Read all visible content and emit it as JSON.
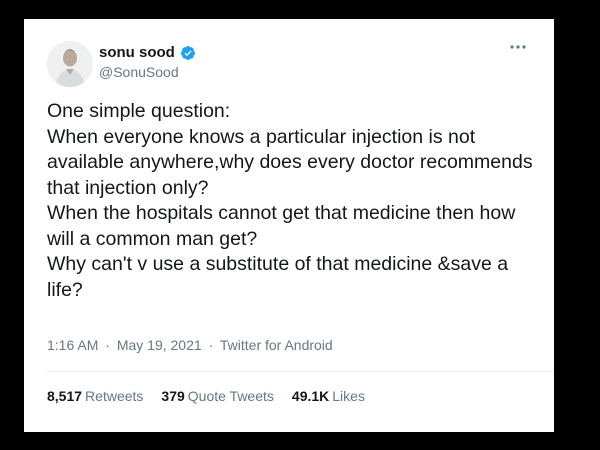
{
  "author": {
    "name": "sonu sood",
    "handle": "@SonuSood"
  },
  "tweet": {
    "lines": [
      "One simple question:",
      "When everyone knows a particular injection is not",
      "available anywhere,why does every doctor recommends",
      "that injection only?",
      "When the hospitals cannot get that medicine then how",
      "will a common man get?",
      "Why can't v use a substitute of that medicine &save a",
      "life?"
    ]
  },
  "meta": {
    "time": "1:16 AM",
    "separator1": "·",
    "date": "May 19, 2021",
    "separator2": "·",
    "source": "Twitter for Android"
  },
  "stats": {
    "retweets_count": "8,517",
    "retweets_label": "Retweets",
    "quotes_count": "379",
    "quotes_label": "Quote Tweets",
    "likes_count": "49.1K",
    "likes_label": "Likes"
  },
  "colors": {
    "verified_badge": "#1da1f2",
    "secondary_text": "#657786",
    "primary_text": "#14171a"
  },
  "icons": {
    "verified": "verified-badge-icon",
    "more": "more-options-icon"
  }
}
